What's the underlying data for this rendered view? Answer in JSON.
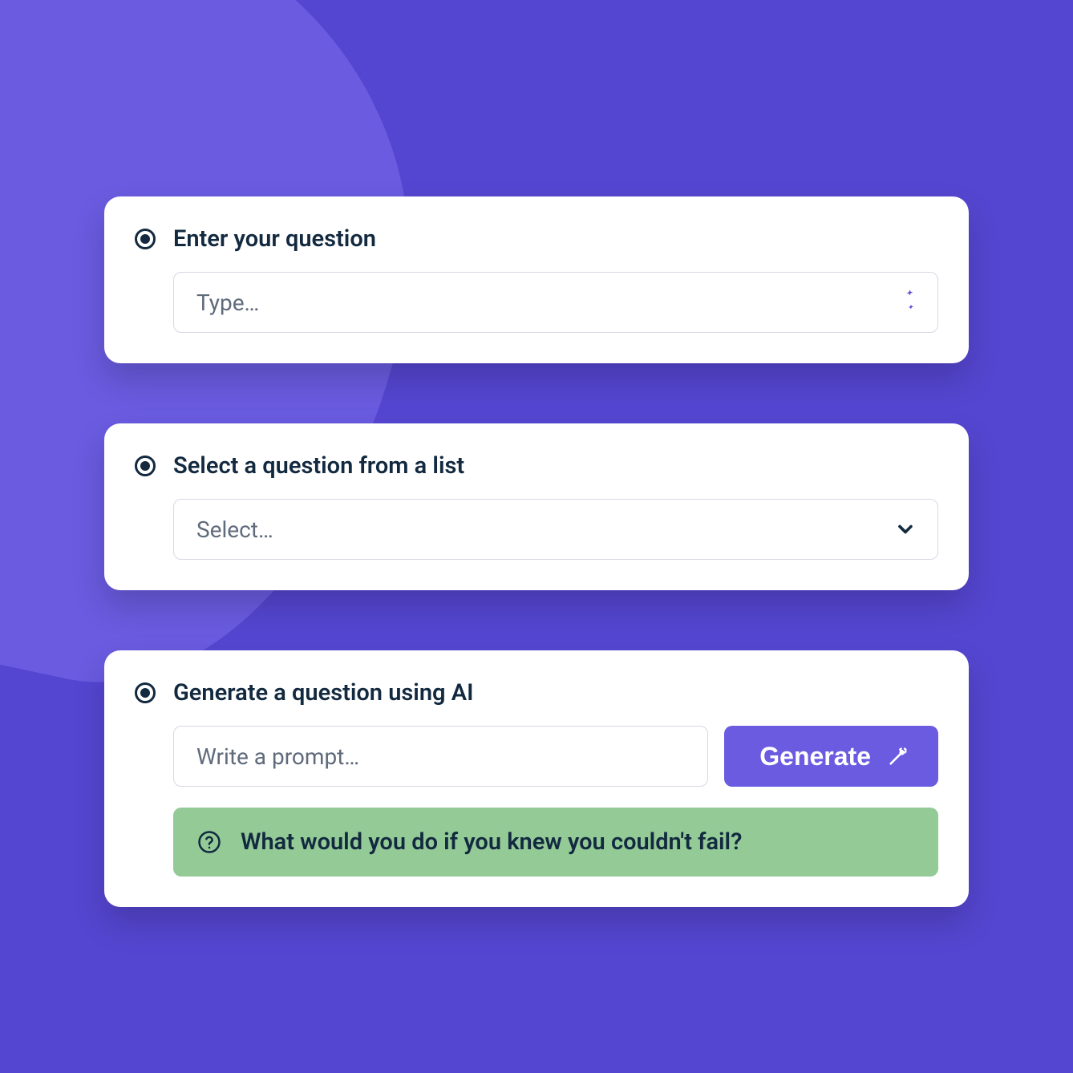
{
  "accent_color": "#5546d1",
  "cards": {
    "enter": {
      "title": "Enter your question",
      "placeholder": "Type…"
    },
    "select": {
      "title": "Select a question from a list",
      "placeholder": "Select…"
    },
    "generate": {
      "title": "Generate a question using AI",
      "prompt_placeholder": "Write a prompt…",
      "button_label": "Generate",
      "result_text": "What would you do if you knew you couldn't fail?"
    }
  }
}
